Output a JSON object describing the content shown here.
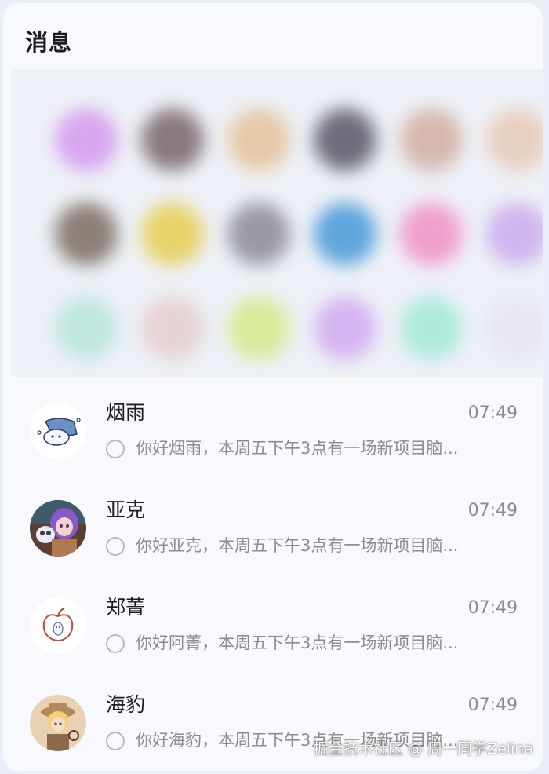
{
  "page": {
    "title": "消息"
  },
  "colors": {
    "background": "#e9eef8",
    "panel": "#f8f9fc",
    "text": "#1d1d1f",
    "muted": "#8c8c90"
  },
  "messages": [
    {
      "name": "烟雨",
      "time": "07:49",
      "preview": "你好烟雨，本周五下午3点有一场新项目脑...",
      "avatar": "ghost-cloud-avatar"
    },
    {
      "name": "亚克",
      "time": "07:49",
      "preview": "你好亚克，本周五下午3点有一场新项目脑...",
      "avatar": "anime-girl-avatar"
    },
    {
      "name": "郑菁",
      "time": "07:49",
      "preview": "你好阿菁，本周五下午3点有一场新项目脑...",
      "avatar": "apple-ghost-avatar"
    },
    {
      "name": "海豹",
      "time": "07:49",
      "preview": "你好海豹，本周五下午3点有一场新项目脑...",
      "avatar": "explorer-girl-avatar"
    }
  ],
  "watermark": "掘金技术社区 @ 周一同学Zelina"
}
